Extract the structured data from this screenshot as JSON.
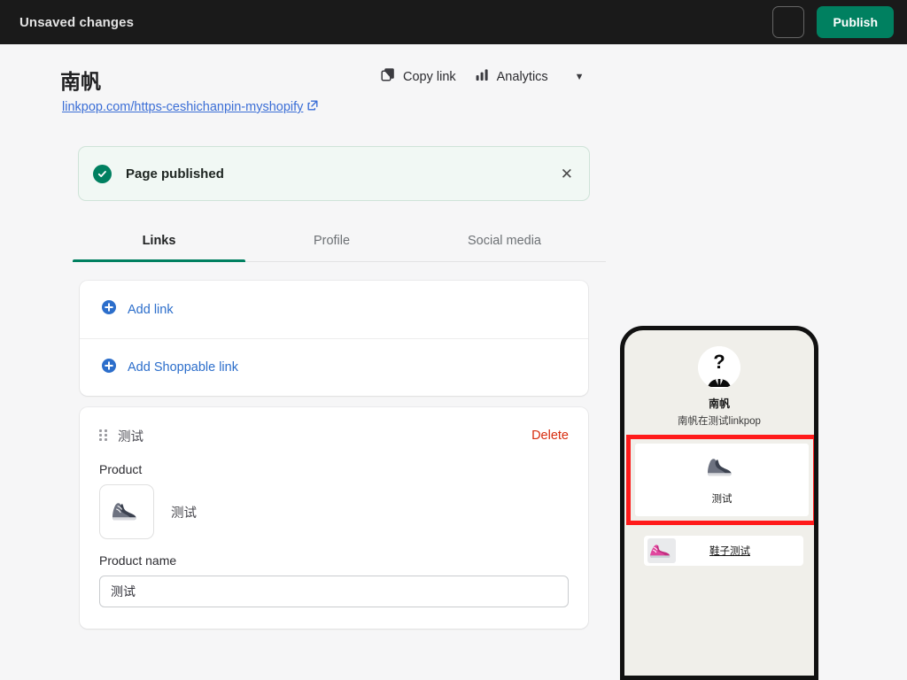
{
  "topbar": {
    "status_text": "Unsaved changes",
    "secondary_button_label": "",
    "publish_label": "Publish",
    "background_color": "#1a1a1a",
    "publish_color": "#008060"
  },
  "header": {
    "title": "南帆",
    "url": "linkpop.com/https-ceshichanpin-myshopify",
    "url_color": "#3b6ed6",
    "actions": [
      {
        "label": "Copy link",
        "icon": "copy-icon"
      },
      {
        "label": "Analytics",
        "icon": "bar-chart-icon"
      }
    ],
    "overflow_icon": "chevron-down-icon"
  },
  "banner": {
    "message": "Page published",
    "icon": "success-check-icon",
    "close_icon": "close-icon",
    "background_color": "#f1f8f4",
    "accent_color": "#008060"
  },
  "tabs": [
    {
      "label": "Links",
      "active": true
    },
    {
      "label": "Profile",
      "active": false
    },
    {
      "label": "Social media",
      "active": false
    }
  ],
  "add_card": {
    "rows": [
      {
        "label": "Add link",
        "icon": "plus-circle-icon"
      },
      {
        "label": "Add Shoppable link",
        "icon": "plus-circle-icon"
      }
    ],
    "link_color": "#2c6ecb"
  },
  "link_card": {
    "drag_icon": "drag-handle-icon",
    "title": "测试",
    "delete_label": "Delete",
    "delete_color": "#d72c0d",
    "product_label": "Product",
    "product_thumb_icon": "sneaker-thumbnail",
    "product_value": "测试",
    "product_name_label": "Product name",
    "product_name_value": "测试",
    "product_name_placeholder": "Product name"
  },
  "preview": {
    "avatar_icon": "anonymous-avatar-icon",
    "name": "南帆",
    "bio": "南帆在测试linkpop",
    "highlight_color": "#ff1a1a",
    "shoppable_card": {
      "image_icon": "sneaker-thumbnail",
      "label": "测试"
    },
    "link_row": {
      "thumb_icon": "pink-sneaker-thumbnail",
      "label": "鞋子测试"
    },
    "background_color": "#f0efea"
  }
}
